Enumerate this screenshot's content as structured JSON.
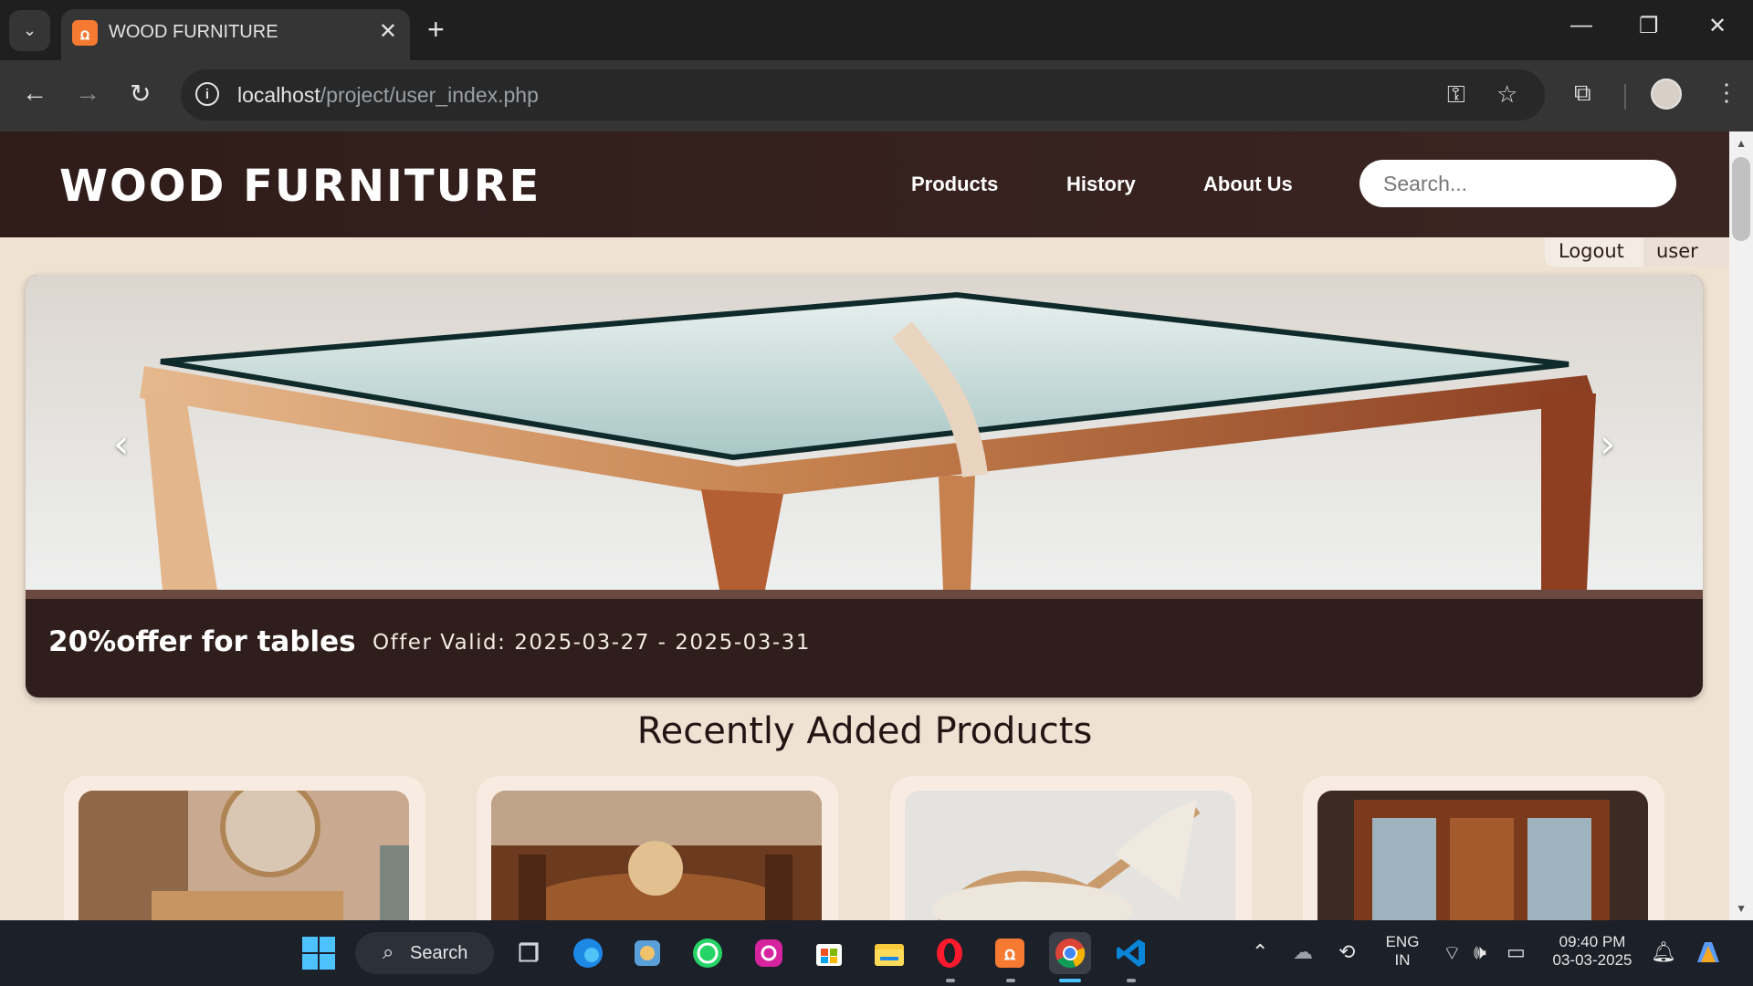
{
  "browser": {
    "tab_title": "WOOD FURNITURE",
    "url_host": "localhost",
    "url_path": "/project/user_index.php",
    "new_tab": "+",
    "close_tab": "✕",
    "window_min": "—",
    "window_restore": "❐",
    "window_close": "✕"
  },
  "site": {
    "logo": "WOOD FURNITURE",
    "nav": [
      "Products",
      "History",
      "About Us"
    ],
    "search_placeholder": "Search...",
    "logout": "Logout",
    "user": "user"
  },
  "slider": {
    "prev": "‹",
    "next": "›",
    "caption_title": "20%offer for tables",
    "caption_offer": "Offer Valid: 2025-03-27 - 2025-03-31"
  },
  "section": {
    "title": "Recently Added Products"
  },
  "taskbar": {
    "search_label": "Search",
    "lang_line1": "ENG",
    "lang_line2": "IN",
    "time": "09:40 PM",
    "date": "03-03-2025"
  },
  "colors": {
    "header_bg": "#3b2522",
    "page_bg": "#efe2d3",
    "caption_bg": "#2f1e1b"
  }
}
